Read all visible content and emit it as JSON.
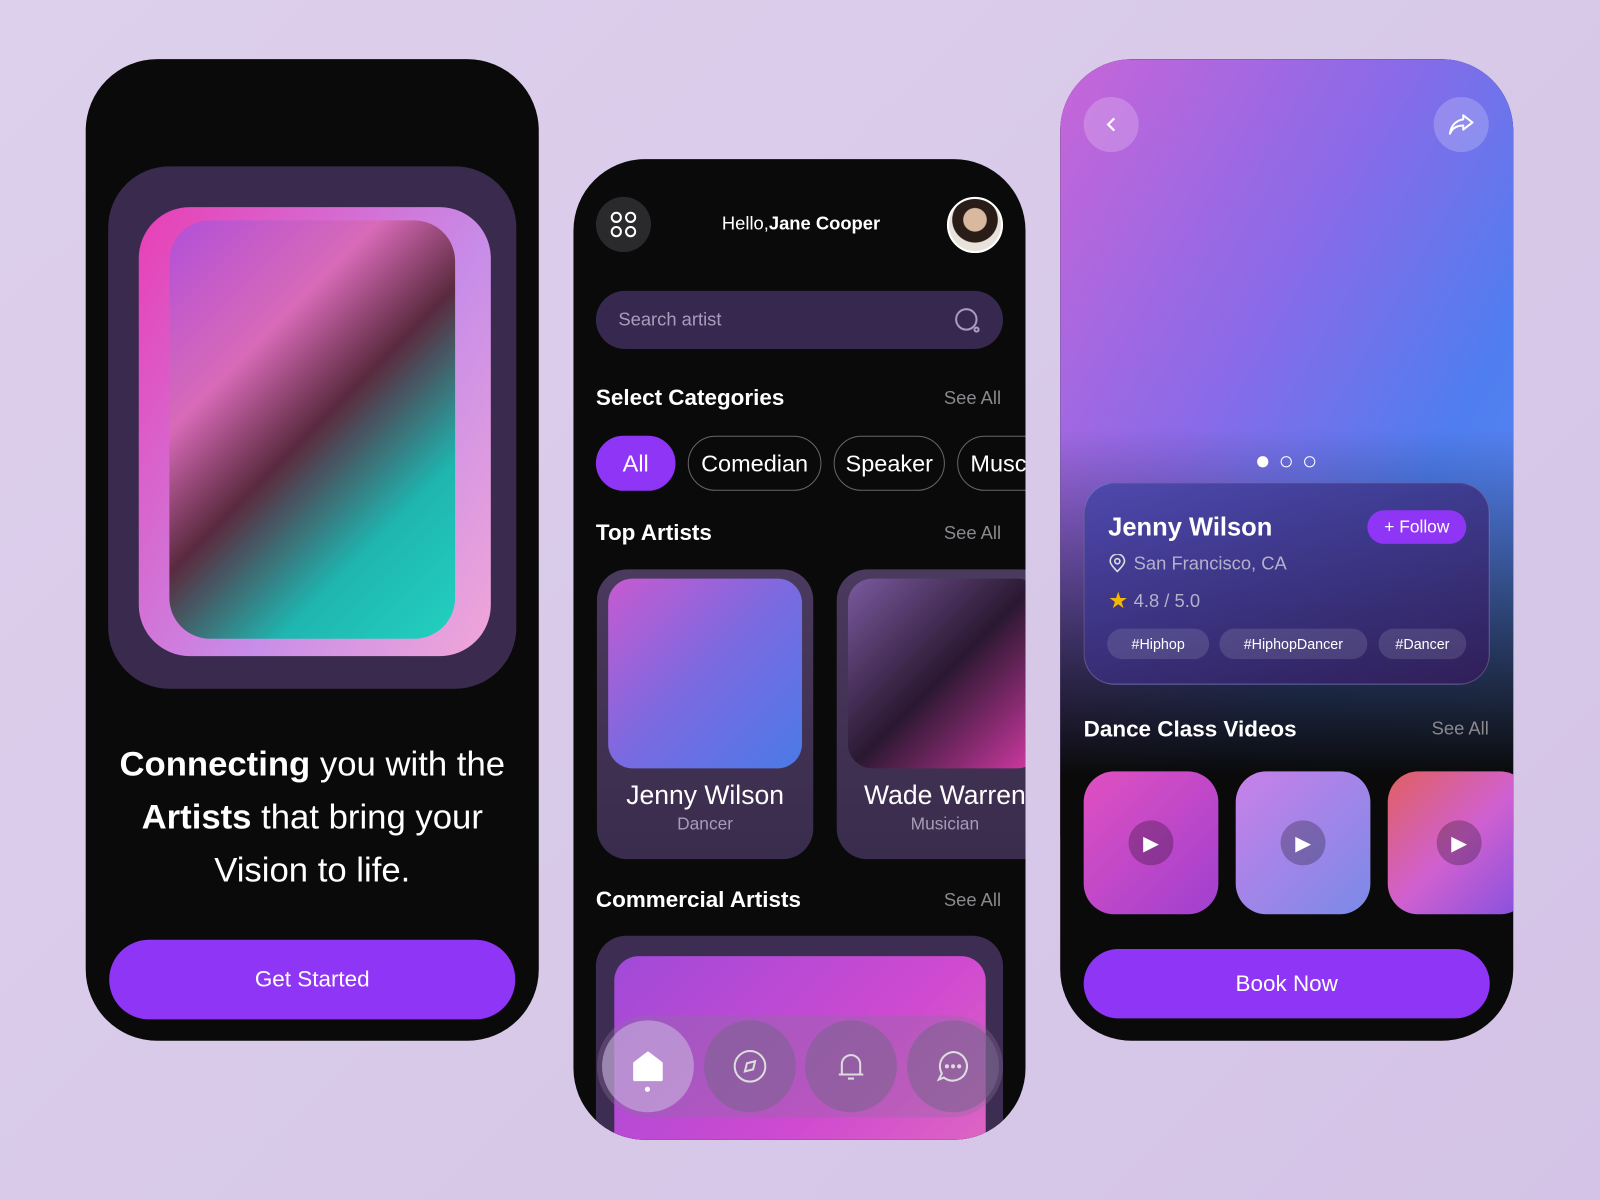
{
  "onboarding": {
    "headline_parts": [
      {
        "text": "Connecting",
        "bold": true
      },
      {
        "text": " you with the",
        "bold": false
      },
      {
        "text": "Artists",
        "bold": true
      },
      {
        "text": " that bring your",
        "bold": false
      },
      {
        "text": "Vision",
        "bold": false
      },
      {
        "text": " to life.",
        "bold": false
      }
    ],
    "cta": "Get Started"
  },
  "home": {
    "greeting": "Hello,",
    "user_name": "Jane Cooper",
    "search_placeholder": "Search artist",
    "categories_title": "Select Categories",
    "see_all": "See All",
    "categories": [
      {
        "label": "All",
        "active": true
      },
      {
        "label": "Comedian"
      },
      {
        "label": "Speaker"
      },
      {
        "label": "Musc"
      }
    ],
    "top_artists_title": "Top Artists",
    "artists": [
      {
        "name": "Jenny Wilson",
        "role": "Dancer"
      },
      {
        "name": "Wade Warren",
        "role": "Musician"
      }
    ],
    "commercial_title": "Commercial Artists",
    "nav": [
      {
        "icon": "home-icon",
        "active": true
      },
      {
        "icon": "compass-icon"
      },
      {
        "icon": "bell-icon"
      },
      {
        "icon": "chat-icon"
      }
    ]
  },
  "profile": {
    "name": "Jenny Wilson",
    "follow": "+ Follow",
    "location": "San Francisco, CA",
    "rating": "4.8 / 5.0",
    "tags": [
      "#Hiphop",
      "#HiphopDancer",
      "#Dancer"
    ],
    "videos_title": "Dance Class Videos",
    "see_all": "See All",
    "book": "Book Now",
    "carousel_index": 0,
    "carousel_count": 3
  },
  "colors": {
    "accent": "#8f35f5",
    "background": "#0a0a0b",
    "star": "#f5b800"
  }
}
